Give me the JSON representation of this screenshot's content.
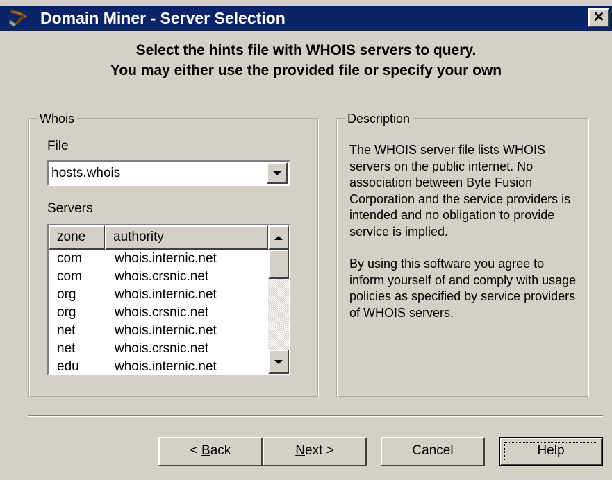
{
  "window": {
    "title": "Domain Miner - Server Selection",
    "close_glyph": "✕",
    "app_icon": "pickaxe-icon"
  },
  "header": {
    "line1": "Select the hints file with WHOIS servers to query.",
    "line2": "You may either use the provided file or specify your own"
  },
  "whois_group": {
    "legend": "Whois",
    "file_label": "File",
    "file_value": "hosts.whois",
    "servers_label": "Servers",
    "columns": [
      "zone",
      "authority"
    ],
    "rows": [
      [
        "com",
        "whois.internic.net"
      ],
      [
        "com",
        "whois.crsnic.net"
      ],
      [
        "org",
        "whois.internic.net"
      ],
      [
        "org",
        "whois.crsnic.net"
      ],
      [
        "net",
        "whois.internic.net"
      ],
      [
        "net",
        "whois.crsnic.net"
      ],
      [
        "edu",
        "whois.internic.net"
      ]
    ]
  },
  "description_group": {
    "legend": "Description",
    "paragraph1": "The WHOIS server file lists WHOIS servers on the public internet. No association between Byte Fusion Corporation and the service providers is intended and no obligation to provide service is implied.",
    "paragraph2": "By using this software you agree to inform yourself of and comply with usage policies as specified by service providers of WHOIS servers."
  },
  "buttons": {
    "back_prefix": "< ",
    "back_mnemonic": "B",
    "back_rest": "ack",
    "next_mnemonic": "N",
    "next_rest": "ext >",
    "cancel": "Cancel",
    "help": "Help"
  },
  "colors": {
    "title_bar": "#0a246a",
    "dialog_face": "#d4d0c8"
  }
}
